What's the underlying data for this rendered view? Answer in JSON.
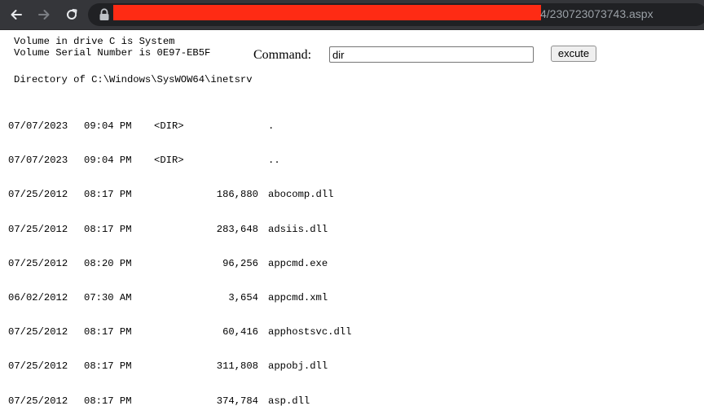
{
  "browser": {
    "url_visible_tail": "4/230723073743.aspx",
    "url_redacted_color": "#fe2b14"
  },
  "console": {
    "volume_line_1": "Volume in drive C is System",
    "volume_line_2": "Volume Serial Number is 0E97-EB5F",
    "directory_header": "Directory of C:\\Windows\\SysWOW64\\inetsrv"
  },
  "command": {
    "label": "Command:",
    "value": "dir",
    "button_label": "excute"
  },
  "listing": [
    {
      "date": "07/07/2023",
      "time": "09:04 PM",
      "dir": "<DIR>",
      "size": "",
      "name": "."
    },
    {
      "date": "07/07/2023",
      "time": "09:04 PM",
      "dir": "<DIR>",
      "size": "",
      "name": ".."
    },
    {
      "date": "07/25/2012",
      "time": "08:17 PM",
      "dir": "",
      "size": "186,880",
      "name": "abocomp.dll"
    },
    {
      "date": "07/25/2012",
      "time": "08:17 PM",
      "dir": "",
      "size": "283,648",
      "name": "adsiis.dll"
    },
    {
      "date": "07/25/2012",
      "time": "08:20 PM",
      "dir": "",
      "size": "96,256",
      "name": "appcmd.exe"
    },
    {
      "date": "06/02/2012",
      "time": "07:30 AM",
      "dir": "",
      "size": "3,654",
      "name": "appcmd.xml"
    },
    {
      "date": "07/25/2012",
      "time": "08:17 PM",
      "dir": "",
      "size": "60,416",
      "name": "apphostsvc.dll"
    },
    {
      "date": "07/25/2012",
      "time": "08:17 PM",
      "dir": "",
      "size": "311,808",
      "name": "appobj.dll"
    },
    {
      "date": "07/25/2012",
      "time": "08:17 PM",
      "dir": "",
      "size": "374,784",
      "name": "asp.dll"
    }
  ]
}
